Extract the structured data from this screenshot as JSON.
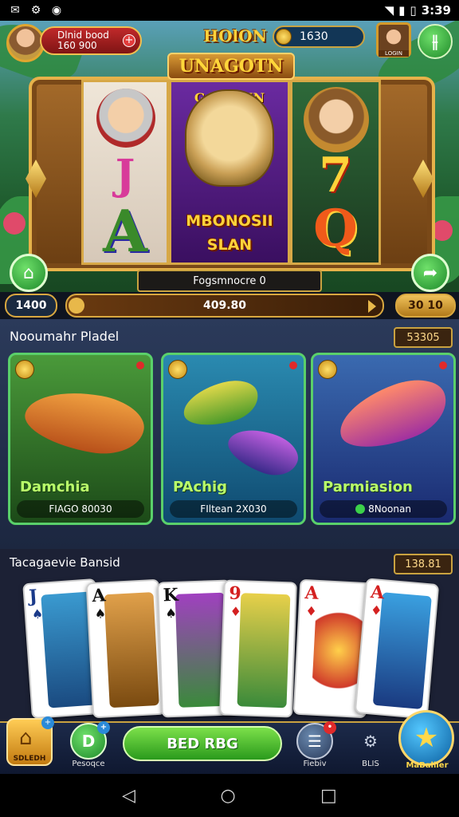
{
  "status": {
    "time": "3:39"
  },
  "header": {
    "balance_line1": "Dlnid bood",
    "balance_line2": "160 900",
    "title": "HOlON",
    "coins": "1630",
    "avatar_label": "LOGIN"
  },
  "slot": {
    "title": "UNAGOTN",
    "reel1_top": "J",
    "reel1_bottom": "A",
    "reel2_top": "GANDSIN",
    "reel2_banner1": "MBONOSII",
    "reel2_banner2": "SLAN",
    "reel3_top": "7",
    "reel3_bottom": "Q",
    "info_bar": "Fogsmnocre 0",
    "left_value": "1400",
    "center_value": "409.80",
    "right_value": "30 10"
  },
  "fish_section": {
    "title": "Nooumahr Pladel",
    "badge": "53305",
    "cards": [
      {
        "name": "Damchia",
        "sub": "FIAGO 80030"
      },
      {
        "name": "PAchig",
        "sub": "FIltean 2X030"
      },
      {
        "name": "Parmiasion",
        "sub": "8Noonan"
      }
    ]
  },
  "card_section": {
    "title": "Tacagaevie Bansid",
    "badge": "138.81",
    "cards": [
      {
        "rank": "J",
        "suit": "♠",
        "color": "#1a3a8a"
      },
      {
        "rank": "A",
        "suit": "♠",
        "color": "#111111"
      },
      {
        "rank": "K",
        "suit": "♠",
        "color": "#111111"
      },
      {
        "rank": "9",
        "suit": "♦",
        "color": "#d42020"
      },
      {
        "rank": "A",
        "suit": "♦",
        "color": "#d42020"
      },
      {
        "rank": "A",
        "suit": "♦",
        "color": "#d42020"
      }
    ]
  },
  "bottom_nav": {
    "home_label": "SDLEDH",
    "item2_label": "Pesoqce",
    "spin_label": "BED RBG",
    "item4_label": "Fiebiv",
    "item5_label": "BLIS",
    "star_label": "MaBallier"
  }
}
